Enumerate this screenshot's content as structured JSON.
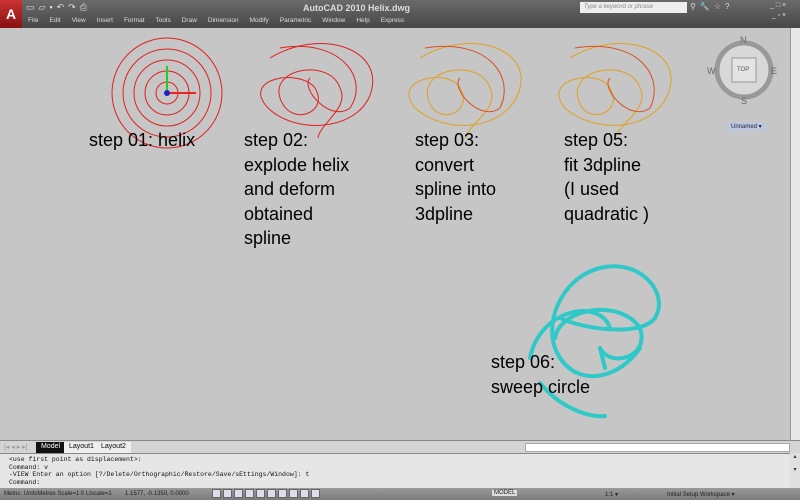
{
  "app": {
    "title": "AutoCAD 2010    Helix.dwg",
    "app_button": "A"
  },
  "menu": [
    "File",
    "Edit",
    "View",
    "Insert",
    "Format",
    "Tools",
    "Draw",
    "Dimension",
    "Modify",
    "Parametric",
    "Window",
    "Help",
    "Express"
  ],
  "search": {
    "placeholder": "Type a keyword or phrase"
  },
  "viewcube": {
    "n": "N",
    "s": "S",
    "e": "E",
    "w": "W",
    "face": "TOP",
    "ucs": "Unnamed ▾"
  },
  "labels": {
    "step1": "step 01: helix",
    "step2": "step 02:\nexplode helix\nand deform\nobtained\nspline",
    "step3": "step 03:\nconvert\nspline into\n3dpline",
    "step5": "step 05:\nfit 3dpline\n(I used\nquadratic )",
    "step6": "step 06:\nsweep circle"
  },
  "tabs": [
    "Model",
    "Layout1",
    "Layout2"
  ],
  "command_lines": [
    "<use first point as displacement>:",
    "Command: v",
    "-VIEW Enter an option [?/Delete/Orthographic/Restore/Save/sEttings/Window]: t",
    "Command:"
  ],
  "status": {
    "units": "Metric: UnitsMetres  Scale=1:0  Ltscale=1",
    "coords": "1.1577, -0.1350, 0.0000",
    "model": "MODEL",
    "annoscale": "1:1 ▾",
    "workspace": "Initial Setup Workspace ▾"
  },
  "colors": {
    "helix": "#e02020",
    "pline": "#e0a020",
    "sweep": "#30c8c8"
  }
}
